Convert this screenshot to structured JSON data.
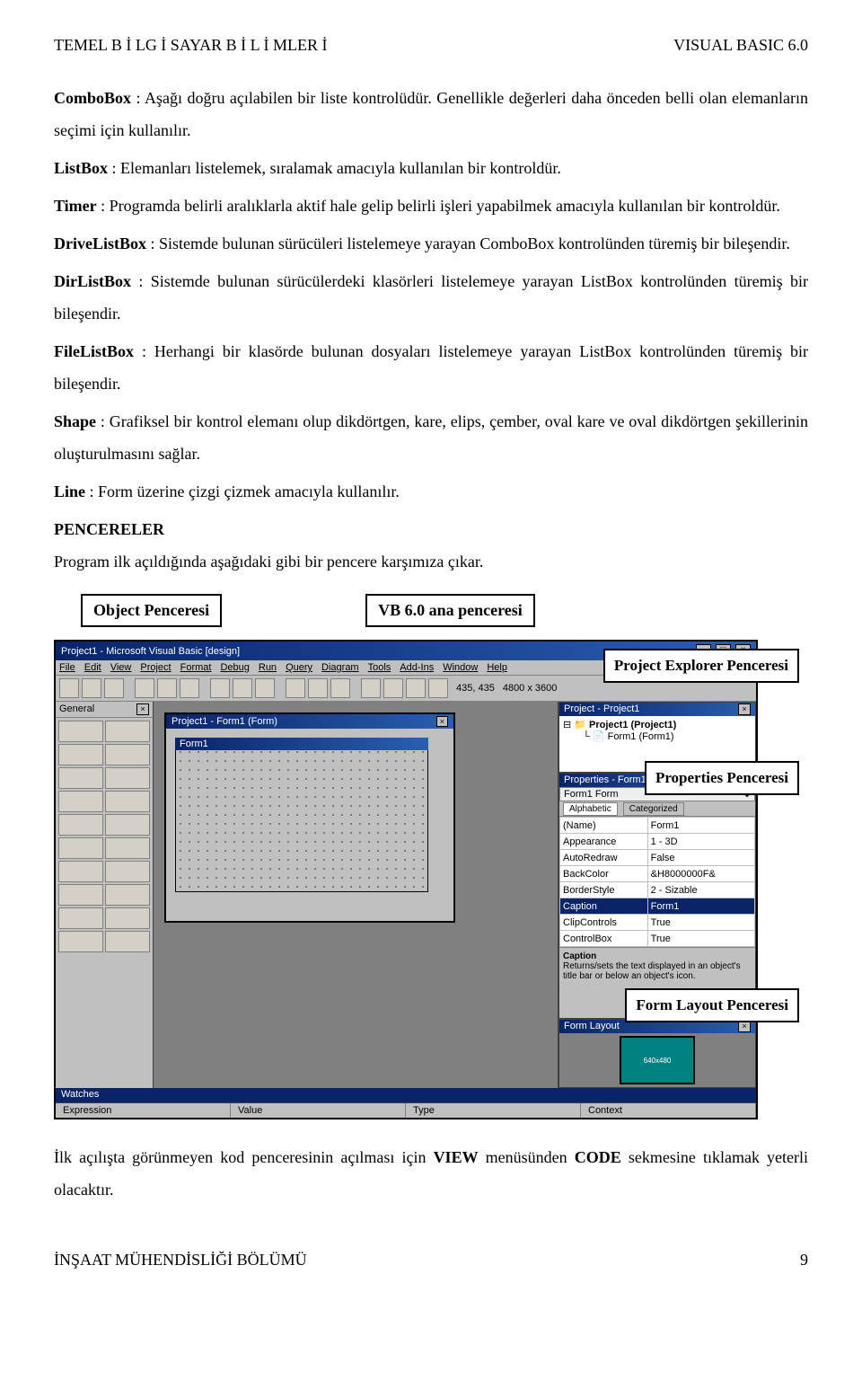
{
  "header": {
    "left": "TEMEL B İ LG İ SAYAR B İ L İ MLER İ",
    "right": "VISUAL BASIC 6.0"
  },
  "defs": {
    "combobox_t": "ComboBox",
    "combobox_d": ": Aşağı doğru açılabilen bir liste kontrolüdür. Genellikle değerleri daha önceden belli olan elemanların seçimi için kullanılır.",
    "listbox_t": "ListBox",
    "listbox_d": ": Elemanları listelemek, sıralamak amacıyla kullanılan bir kontroldür.",
    "timer_t": "Timer",
    "timer_d": ": Programda belirli aralıklarla aktif hale gelip belirli işleri yapabilmek amacıyla kullanılan bir kontroldür.",
    "drivelist_t": "DriveListBox",
    "drivelist_d": ": Sistemde bulunan sürücüleri listelemeye yarayan ComboBox kontrolünden türemiş bir bileşendir.",
    "dirlist_t": "DirListBox",
    "dirlist_d": ": Sistemde bulunan sürücülerdeki klasörleri listelemeye yarayan ListBox kontrolünden türemiş bir bileşendir.",
    "filelist_t": "FileListBox",
    "filelist_d": ": Herhangi bir klasörde bulunan dosyaları listelemeye yarayan ListBox kontrolünden türemiş bir bileşendir.",
    "shape_t": "Shape",
    "shape_d": ": Grafiksel bir kontrol elemanı olup dikdörtgen, kare, elips, çember, oval kare ve oval dikdörtgen şekillerinin oluşturulmasını sağlar.",
    "line_t": "Line",
    "line_d": ": Form üzerine çizgi çizmek amacıyla kullanılır.",
    "pencereler": "PENCERELER",
    "pencereler_d": "Program ilk açıldığında aşağıdaki gibi bir pencere karşımıza çıkar."
  },
  "labels": {
    "object": "Object Penceresi",
    "main": "VB 6.0 ana penceresi",
    "project": "Project Explorer Penceresi",
    "properties": "Properties Penceresi",
    "formlayout": "Form Layout Penceresi"
  },
  "ide": {
    "title": "Project1 - Microsoft Visual Basic [design]",
    "menus": [
      "File",
      "Edit",
      "View",
      "Project",
      "Format",
      "Debug",
      "Run",
      "Query",
      "Diagram",
      "Tools",
      "Add-Ins",
      "Window",
      "Help"
    ],
    "coords": "435, 435",
    "size": "4800 x 3600",
    "toolbox_title": "General",
    "form_outer": "Project1 - Form1 (Form)",
    "form_inner": "Form1",
    "project_panel": "Project - Project1",
    "project_tree_root": "Project1 (Project1)",
    "project_tree_leaf": "Form1 (Form1)",
    "props_panel": "Properties - Form1",
    "props_object": "Form1 Form",
    "tabs": {
      "alpha": "Alphabetic",
      "cat": "Categorized"
    },
    "props": [
      {
        "k": "(Name)",
        "v": "Form1"
      },
      {
        "k": "Appearance",
        "v": "1 - 3D"
      },
      {
        "k": "AutoRedraw",
        "v": "False"
      },
      {
        "k": "BackColor",
        "v": "&H8000000F&"
      },
      {
        "k": "BorderStyle",
        "v": "2 - Sizable"
      },
      {
        "k": "Caption",
        "v": "Form1"
      },
      {
        "k": "ClipControls",
        "v": "True"
      },
      {
        "k": "ControlBox",
        "v": "True"
      }
    ],
    "caption_help_t": "Caption",
    "caption_help_d": "Returns/sets the text displayed in an object's title bar or below an object's icon.",
    "formlayout_panel": "Form Layout",
    "formlayout_label": "640x480",
    "watches_title": "Watches",
    "watch_cols": [
      "Expression",
      "Value",
      "Type",
      "Context"
    ]
  },
  "closing": {
    "p1a": "İlk açılışta görünmeyen kod penceresinin açılması için ",
    "p1b": "VIEW",
    "p1c": " menüsünden ",
    "p1d": "CODE",
    "p1e": " sekmesine tıklamak yeterli olacaktır."
  },
  "footer": {
    "left": "İNŞAAT MÜHENDİSLİĞİ BÖLÜMÜ",
    "right": "9"
  }
}
